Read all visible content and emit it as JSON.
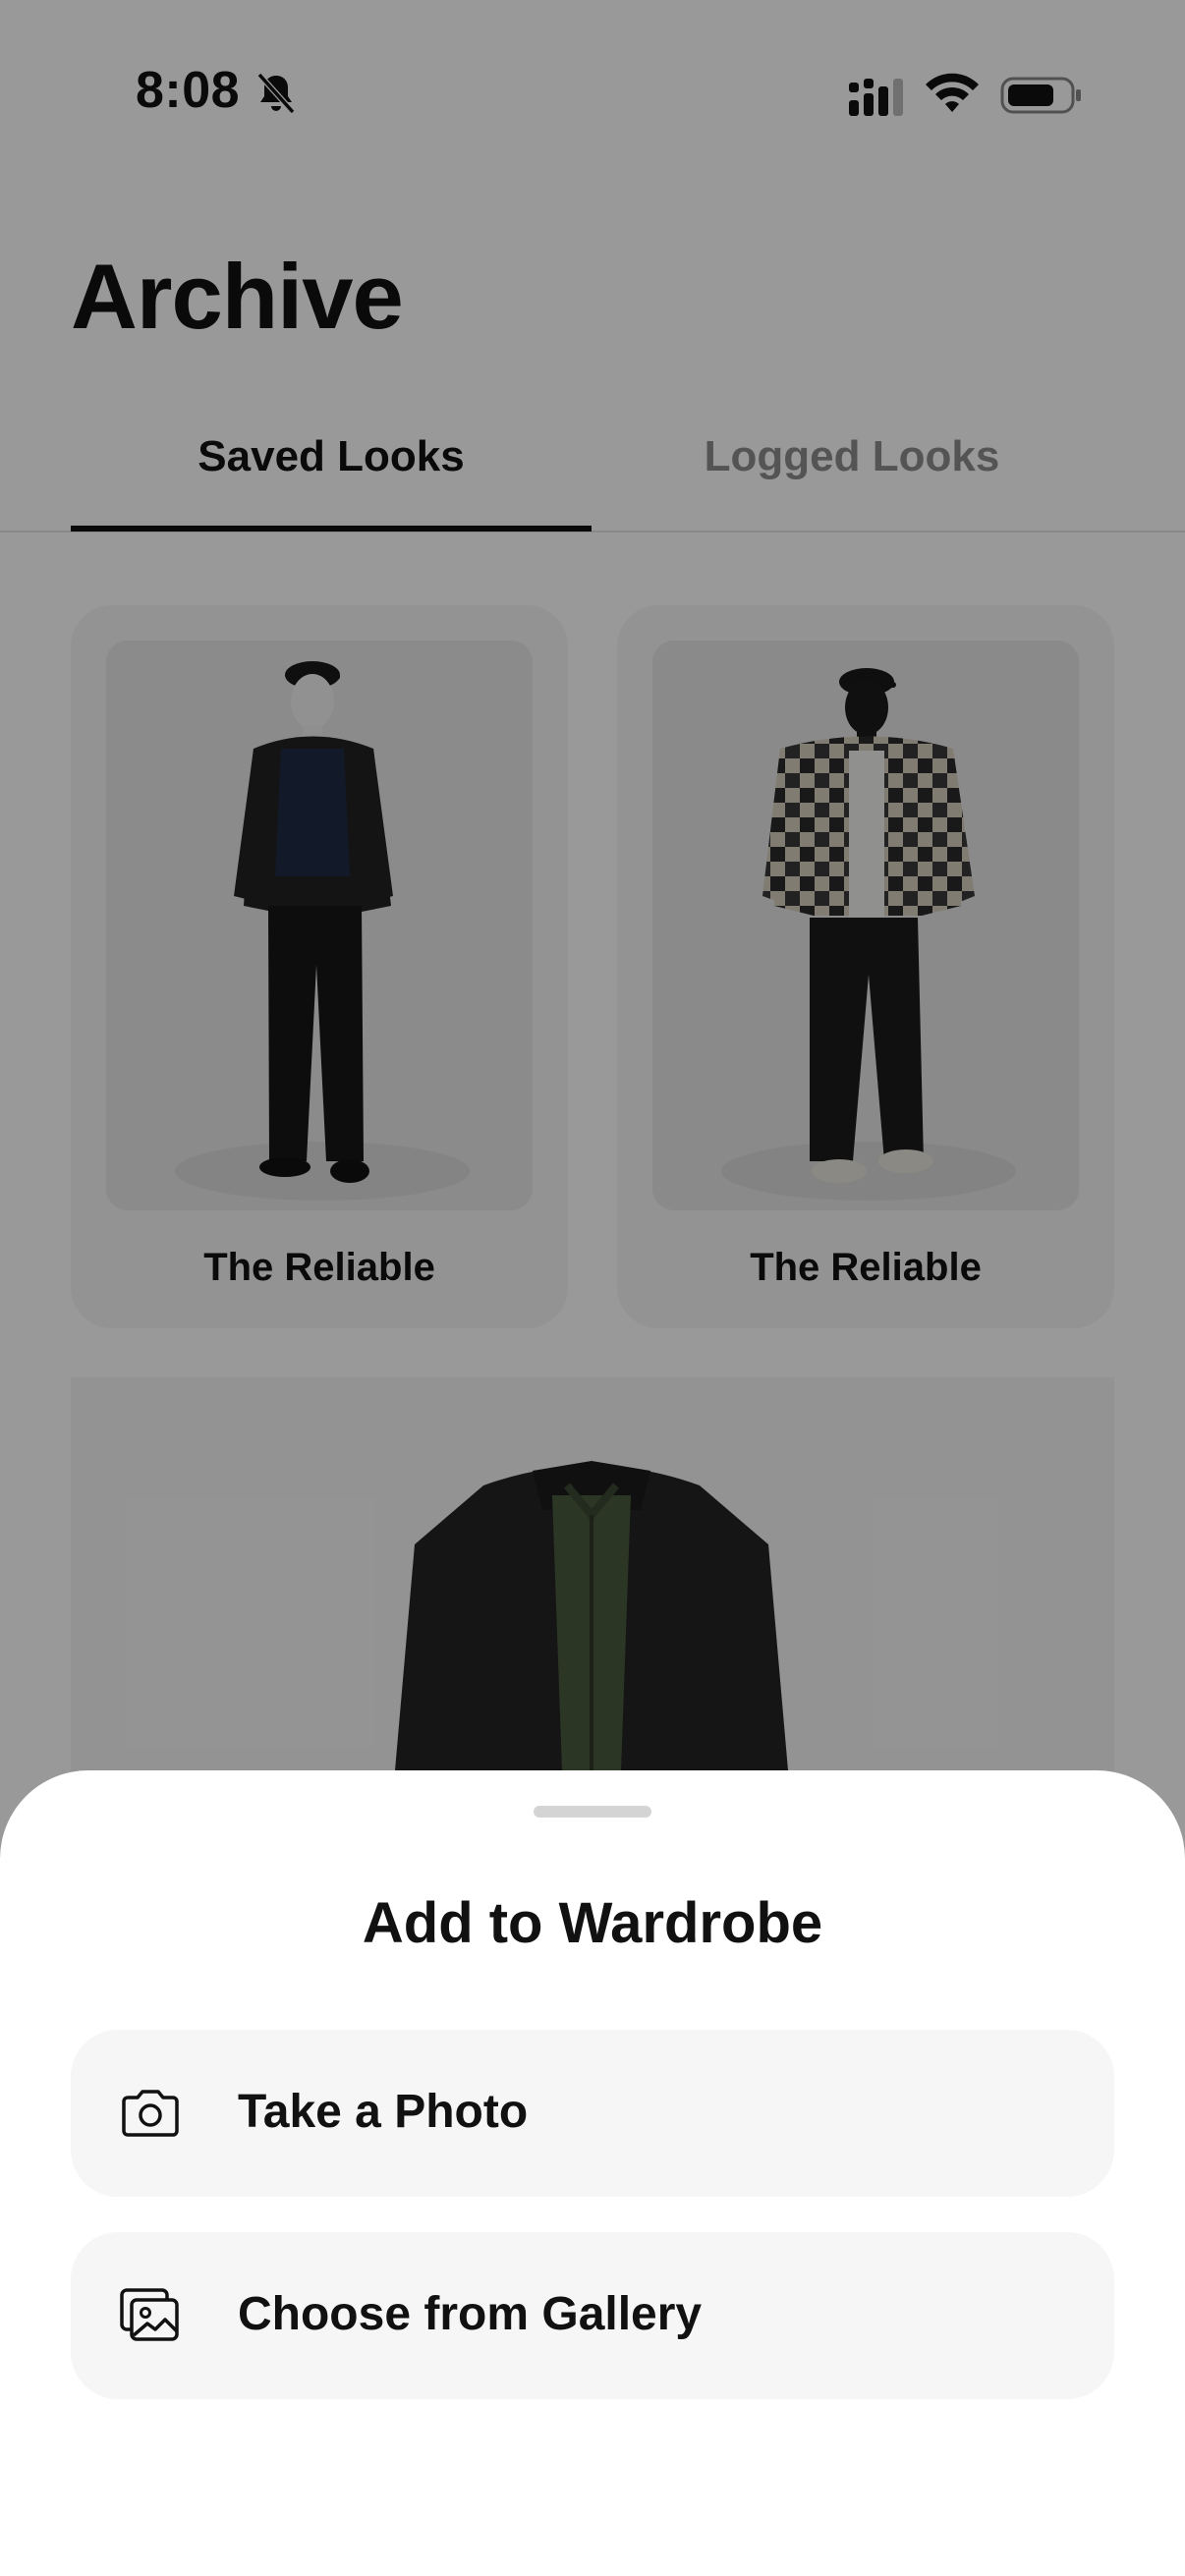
{
  "status_bar": {
    "time": "8:08",
    "icons": [
      "bell-slash-icon",
      "cellular-signal-icon",
      "wifi-icon",
      "battery-icon"
    ]
  },
  "page": {
    "title": "Archive"
  },
  "tabs": [
    {
      "label": "Saved Looks",
      "active": true
    },
    {
      "label": "Logged Looks",
      "active": false
    }
  ],
  "looks": [
    {
      "name": "The Reliable",
      "image": "mannequin-dark-jacket-navy-sweater"
    },
    {
      "name": "The Reliable",
      "image": "mannequin-plaid-flannel-shirt-jacket"
    },
    {
      "name": "",
      "image": "black-jacket-over-olive-shirt"
    }
  ],
  "sheet": {
    "title": "Add to Wardrobe",
    "options": [
      {
        "label": "Take a Photo",
        "icon": "camera-icon"
      },
      {
        "label": "Choose from Gallery",
        "icon": "gallery-icon"
      }
    ]
  },
  "colors": {
    "accent": "#111111",
    "inactive_tab": "#8c8c8c",
    "card_bg": "#f6f6f6",
    "overlay": "rgba(0,0,0,0.40)"
  }
}
